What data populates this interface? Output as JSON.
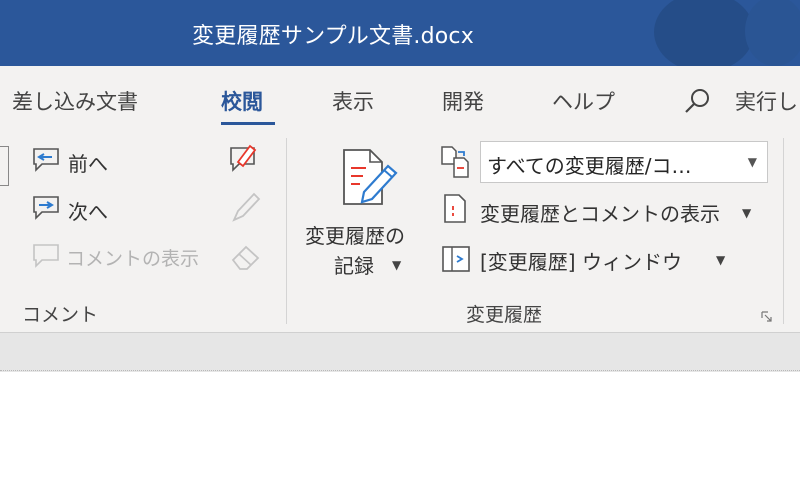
{
  "window": {
    "title": "変更履歴サンプル文書.docx"
  },
  "tabs": [
    {
      "label": "差し込み文書"
    },
    {
      "label": "校閲",
      "active": true
    },
    {
      "label": "表示"
    },
    {
      "label": "開発"
    },
    {
      "label": "ヘルプ"
    }
  ],
  "search": {
    "label": "実行し"
  },
  "comments_group": {
    "label": "コメント",
    "previous": "前へ",
    "next": "次へ",
    "show_comments": "コメントの表示"
  },
  "tracking_group": {
    "label": "変更履歴",
    "track_changes_line1": "変更履歴の",
    "track_changes_line2": "記録",
    "markup_dropdown_value": "すべての変更履歴/コ…",
    "show_markup": "変更履歴とコメントの表示",
    "reviewing_pane": "[変更履歴] ウィンドウ"
  },
  "colors": {
    "accent": "#2b579a",
    "ribbon_bg": "#f3f2f1",
    "pen_red": "#e8372b",
    "icon_blue": "#2e7bcf"
  }
}
